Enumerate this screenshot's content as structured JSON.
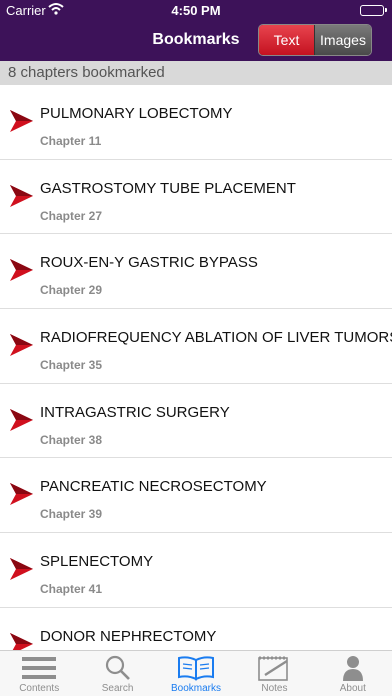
{
  "status_bar": {
    "carrier": "Carrier",
    "time": "4:50 PM"
  },
  "nav": {
    "title": "Bookmarks",
    "segments": [
      {
        "label": "Text",
        "selected": true
      },
      {
        "label": "Images",
        "selected": false
      }
    ]
  },
  "section_header": "8 chapters bookmarked",
  "bookmarks": [
    {
      "title": "PULMONARY LOBECTOMY",
      "chapter": "Chapter 11"
    },
    {
      "title": "GASTROSTOMY TUBE PLACEMENT",
      "chapter": "Chapter 27"
    },
    {
      "title": "ROUX-EN-Y GASTRIC BYPASS",
      "chapter": "Chapter 29"
    },
    {
      "title": "RADIOFREQUENCY ABLATION OF LIVER TUMORS",
      "chapter": "Chapter 35"
    },
    {
      "title": "INTRAGASTRIC SURGERY",
      "chapter": "Chapter 38"
    },
    {
      "title": "PANCREATIC NECROSECTOMY",
      "chapter": "Chapter 39"
    },
    {
      "title": "SPLENECTOMY",
      "chapter": "Chapter 41"
    },
    {
      "title": "DONOR NEPHRECTOMY",
      "chapter": ""
    }
  ],
  "tabs": [
    {
      "label": "Contents",
      "icon": "list-icon",
      "active": false
    },
    {
      "label": "Search",
      "icon": "search-icon",
      "active": false
    },
    {
      "label": "Bookmarks",
      "icon": "book-icon",
      "active": true
    },
    {
      "label": "Notes",
      "icon": "notepad-icon",
      "active": false
    },
    {
      "label": "About",
      "icon": "person-icon",
      "active": false
    }
  ],
  "colors": {
    "nav_bg": "#3d1259",
    "accent_red": "#d0101e",
    "tab_active": "#1a7cf0"
  }
}
